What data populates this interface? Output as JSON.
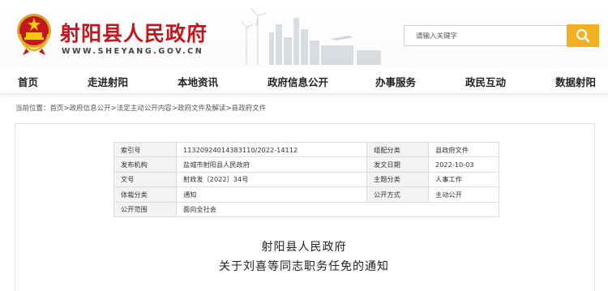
{
  "header": {
    "site_title": "射阳县人民政府",
    "site_url": "WWW.SHEYANG.GOV.CN",
    "emblem_icon": "national-emblem-icon",
    "brand_color": "#c4161c"
  },
  "search": {
    "placeholder": "请输入关键字",
    "button_icon": "search-icon",
    "button_color": "#f0b020"
  },
  "nav": {
    "items": [
      {
        "label": "首页"
      },
      {
        "label": "走进射阳"
      },
      {
        "label": "本地资讯"
      },
      {
        "label": "政府信息公开"
      },
      {
        "label": "办事服务"
      },
      {
        "label": "政民互动"
      },
      {
        "label": "数据射阳"
      }
    ]
  },
  "breadcrumb": {
    "prefix": "当前位置：",
    "items": [
      {
        "label": "首页"
      },
      {
        "label": "政府信息公开"
      },
      {
        "label": "法定主动公开内容"
      },
      {
        "label": "政府文件及解读"
      },
      {
        "label": "县政府文件"
      }
    ],
    "separator": ">"
  },
  "meta": {
    "rows": [
      [
        {
          "k": "索引号",
          "v": "11320924014383110/2022-14112"
        },
        {
          "k": "组配分类",
          "v": "县政府文件"
        }
      ],
      [
        {
          "k": "发布机构",
          "v": "盐城市射阳县人民政府"
        },
        {
          "k": "发文日期",
          "v": "2022-10-03"
        }
      ],
      [
        {
          "k": "文号",
          "v": "射政发〔2022〕34号"
        },
        {
          "k": "主题分类",
          "v": "人事工作"
        }
      ],
      [
        {
          "k": "体裁分类",
          "v": "通知"
        },
        {
          "k": "公开方式",
          "v": "主动公开"
        }
      ]
    ],
    "scope": {
      "k": "公开范围",
      "v": "面向全社会"
    }
  },
  "document": {
    "issuer": "射阳县人民政府",
    "title": "关于刘喜等同志职务任免的通知"
  }
}
